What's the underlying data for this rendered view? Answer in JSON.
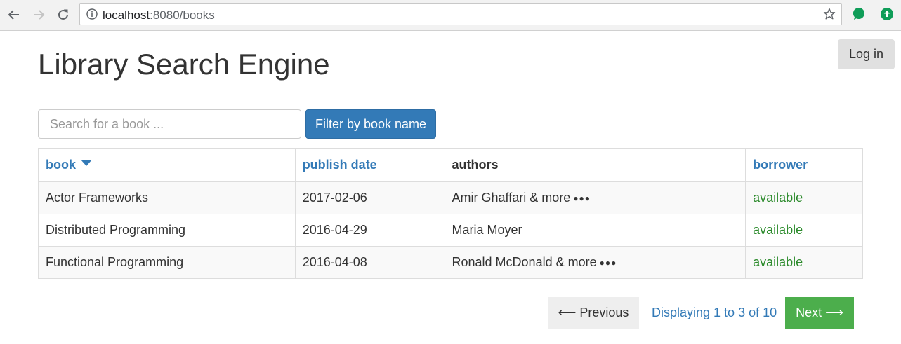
{
  "browser": {
    "url_host": "localhost",
    "url_rest": ":8080/books",
    "accent_green": "#0f9d58"
  },
  "header": {
    "title": "Library Search Engine",
    "login_label": "Log in"
  },
  "search": {
    "placeholder": "Search for a book ...",
    "value": "",
    "filter_label": "Filter by book name"
  },
  "table": {
    "columns": [
      "book",
      "publish date",
      "authors",
      "borrower"
    ],
    "sorted_column_icon": "caret-down-icon",
    "rows": [
      {
        "book": "Actor Frameworks",
        "publish_date": "2017-02-06",
        "authors": "Amir Ghaffari & more",
        "more": "●●●",
        "borrower": "available"
      },
      {
        "book": "Distributed Programming",
        "publish_date": "2016-04-29",
        "authors": "Maria Moyer",
        "more": "",
        "borrower": "available"
      },
      {
        "book": "Functional Programming",
        "publish_date": "2016-04-08",
        "authors": "Ronald McDonald & more",
        "more": "●●●",
        "borrower": "available"
      }
    ]
  },
  "pager": {
    "previous_label": "⟵ Previous",
    "status": "Displaying 1 to 3 of 10",
    "next_label": "Next ⟶"
  }
}
